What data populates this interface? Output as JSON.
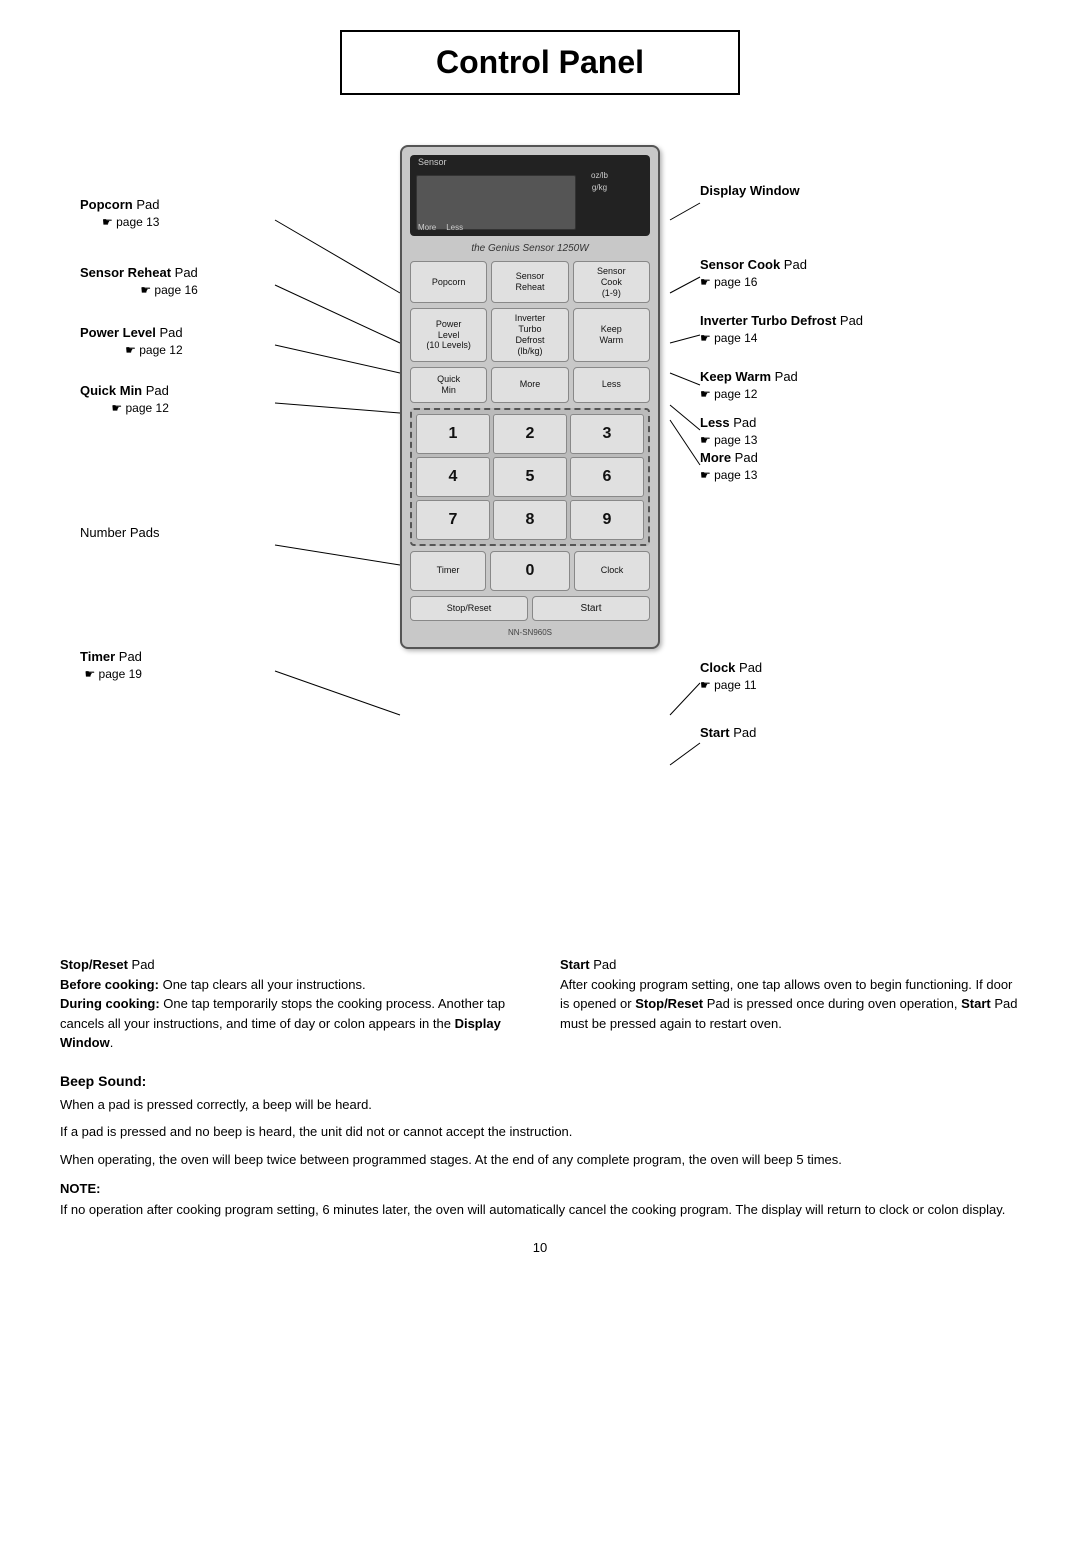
{
  "title": "Control Panel",
  "panel": {
    "display": {
      "sensor_label": "Sensor",
      "oz_lb": "oz/lb",
      "g_kg": "g/kg",
      "more": "More",
      "less": "Less"
    },
    "brand": "the Genius Sensor 1250W",
    "buttons": {
      "popcorn": "Popcorn",
      "sensor_reheat": "Sensor Reheat",
      "sensor_cook": "Sensor Cook (1-9)",
      "power_level": "Power Level (10 Levels)",
      "inverter_turbo_defrost": "Inverter Turbo Defrost (lb/kg)",
      "keep_warm": "Keep Warm",
      "quick_min": "Quick Min",
      "more": "More",
      "less": "Less",
      "timer": "Timer",
      "zero": "0",
      "clock": "Clock",
      "stop_reset": "Stop/Reset",
      "start": "Start"
    },
    "numpad": [
      "1",
      "2",
      "3",
      "4",
      "5",
      "6",
      "7",
      "8",
      "9"
    ],
    "model": "NN-SN960S"
  },
  "annotations": {
    "left": [
      {
        "id": "popcorn",
        "label": "Popcorn",
        "suffix": " Pad",
        "page": "☛ page 13"
      },
      {
        "id": "sensor_reheat",
        "label": "Sensor Reheat",
        "suffix": " Pad",
        "page": "☛ page 16"
      },
      {
        "id": "power_level",
        "label": "Power Level",
        "suffix": " Pad",
        "page": "☛ page 12"
      },
      {
        "id": "quick_min",
        "label": "Quick Min",
        "suffix": " Pad",
        "page": "☛ page 12"
      },
      {
        "id": "number_pads",
        "label": "Number Pads",
        "suffix": "",
        "page": ""
      },
      {
        "id": "timer",
        "label": "Timer",
        "suffix": " Pad",
        "page": "☛ page 19"
      }
    ],
    "right": [
      {
        "id": "display_window",
        "label": "Display Window",
        "suffix": "",
        "page": ""
      },
      {
        "id": "sensor_cook",
        "label": "Sensor Cook",
        "suffix": " Pad",
        "page": "☛ page 16"
      },
      {
        "id": "inverter_turbo_defrost",
        "label": "Inverter Turbo Defrost",
        "suffix": " Pad",
        "page": "☛ page 14"
      },
      {
        "id": "keep_warm",
        "label": "Keep Warm",
        "suffix": " Pad",
        "page": "☛ page 12"
      },
      {
        "id": "less",
        "label": "Less",
        "suffix": " Pad",
        "page": "☛ page 13"
      },
      {
        "id": "more",
        "label": "More",
        "suffix": " Pad",
        "page": "☛ page 13"
      },
      {
        "id": "clock",
        "label": "Clock",
        "suffix": " Pad",
        "page": "☛ page 11"
      },
      {
        "id": "start_pad",
        "label": "Start",
        "suffix": " Pad",
        "page": ""
      }
    ]
  },
  "stop_reset": {
    "label": "Stop/Reset",
    "suffix": " Pad",
    "intro": "Before cooking:",
    "before": "One tap clears all your instructions.",
    "during_intro": "During cooking:",
    "during": "One tap temporarily stops the cooking process. Another tap cancels all your instructions, and time of day or colon appears in the",
    "display_window": "Display Window",
    "period": "."
  },
  "start": {
    "label": "Start",
    "suffix": " Pad",
    "text": "After cooking program setting, one tap allows oven to begin functioning. If door is opened or",
    "stop_reset_ref": "Stop/Reset",
    "middle": " Pad is pressed once during oven operation,",
    "start_ref": " Start",
    "end": " Pad must be pressed again to restart oven."
  },
  "beep_sound": {
    "title": "Beep Sound:",
    "lines": [
      "When a pad is pressed correctly, a beep will be heard.",
      "If a pad is pressed and no beep is heard, the unit did not or cannot accept the instruction.",
      "When operating, the oven will beep twice between programmed stages. At the end of any complete program, the oven will beep 5 times."
    ]
  },
  "note": {
    "title": "NOTE:",
    "text": "If no operation after cooking program setting, 6 minutes later, the oven will automatically cancel the cooking program. The display will return to clock or colon display."
  },
  "page_number": "10"
}
